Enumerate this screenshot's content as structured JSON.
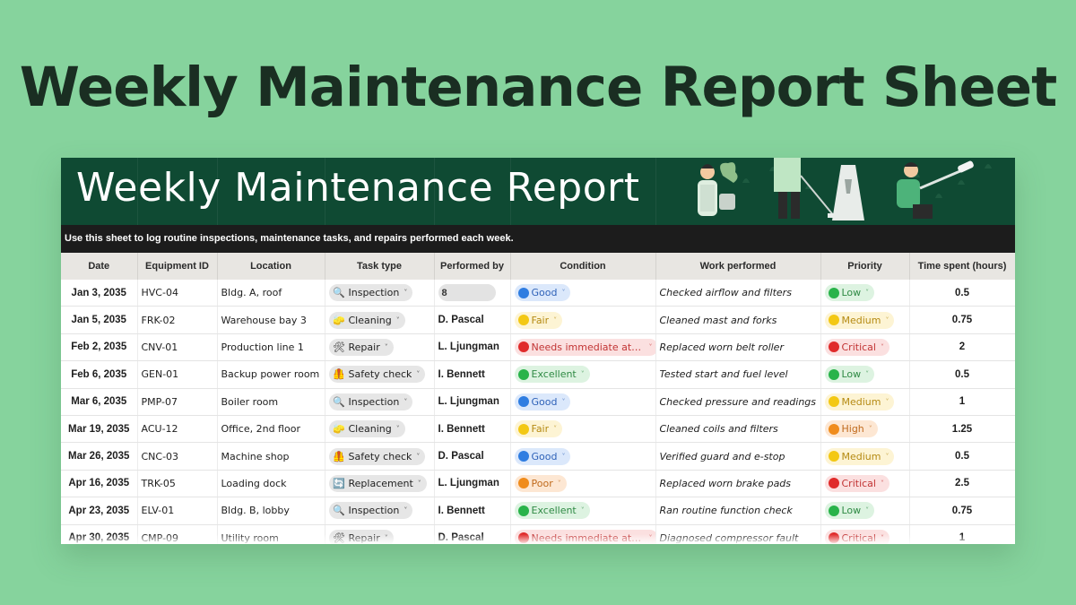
{
  "page_title": "Weekly Maintenance Report Sheet",
  "banner": {
    "title": "Weekly Maintenance Report",
    "subtitle": "Use this sheet to log routine inspections, maintenance tasks, and repairs performed each week."
  },
  "columns": [
    "Date",
    "Equipment ID",
    "Location",
    "Task type",
    "Performed by",
    "Condition",
    "Work performed",
    "Priority",
    "Time spent (hours)"
  ],
  "colors": {
    "background": "#86d39d",
    "banner": "#0f4a33",
    "subbar": "#1c1c1c",
    "header_row": "#e8e6e2",
    "status_blue": "#2f7de1",
    "status_green": "#29b34a",
    "status_yellow": "#f3c814",
    "status_red": "#e02b2b",
    "status_orange": "#f08c1c"
  },
  "task_icons": {
    "Inspection": "magnifier-icon",
    "Cleaning": "sponge-icon",
    "Repair": "tools-icon",
    "Safety check": "safety-vest-icon",
    "Replacement": "cycle-arrows-icon"
  },
  "rows": [
    {
      "date": "Jan 3, 2035",
      "equipment_id": "HVC-04",
      "location": "Bldg. A, roof",
      "task_type": "Inspection",
      "performed_by": "8",
      "condition": "Good",
      "work_performed": "Checked airflow and filters",
      "priority": "Low",
      "time_spent": "0.5"
    },
    {
      "date": "Jan 5, 2035",
      "equipment_id": "FRK-02",
      "location": "Warehouse bay 3",
      "task_type": "Cleaning",
      "performed_by": "D. Pascal",
      "condition": "Fair",
      "work_performed": "Cleaned mast and forks",
      "priority": "Medium",
      "time_spent": "0.75"
    },
    {
      "date": "Feb 2, 2035",
      "equipment_id": "CNV-01",
      "location": "Production line 1",
      "task_type": "Repair",
      "performed_by": "L. Ljungman",
      "condition": "Needs immediate att...",
      "work_performed": "Replaced worn belt roller",
      "priority": "Critical",
      "time_spent": "2"
    },
    {
      "date": "Feb 6, 2035",
      "equipment_id": "GEN-01",
      "location": "Backup power room",
      "task_type": "Safety check",
      "performed_by": "I. Bennett",
      "condition": "Excellent",
      "work_performed": "Tested start and fuel level",
      "priority": "Low",
      "time_spent": "0.5"
    },
    {
      "date": "Mar 6, 2035",
      "equipment_id": "PMP-07",
      "location": "Boiler room",
      "task_type": "Inspection",
      "performed_by": "L. Ljungman",
      "condition": "Good",
      "work_performed": "Checked pressure and readings",
      "priority": "Medium",
      "time_spent": "1"
    },
    {
      "date": "Mar 19, 2035",
      "equipment_id": "ACU-12",
      "location": "Office, 2nd floor",
      "task_type": "Cleaning",
      "performed_by": "I. Bennett",
      "condition": "Fair",
      "work_performed": "Cleaned coils and filters",
      "priority": "High",
      "time_spent": "1.25"
    },
    {
      "date": "Mar 26, 2035",
      "equipment_id": "CNC-03",
      "location": "Machine shop",
      "task_type": "Safety check",
      "performed_by": "D. Pascal",
      "condition": "Good",
      "work_performed": "Verified guard and e-stop",
      "priority": "Medium",
      "time_spent": "0.5"
    },
    {
      "date": "Apr 16, 2035",
      "equipment_id": "TRK-05",
      "location": "Loading dock",
      "task_type": "Replacement",
      "performed_by": "L. Ljungman",
      "condition": "Poor",
      "work_performed": "Replaced worn brake pads",
      "priority": "Critical",
      "time_spent": "2.5"
    },
    {
      "date": "Apr 23, 2035",
      "equipment_id": "ELV-01",
      "location": "Bldg. B, lobby",
      "task_type": "Inspection",
      "performed_by": "I. Bennett",
      "condition": "Excellent",
      "work_performed": "Ran routine function check",
      "priority": "Low",
      "time_spent": "0.75"
    },
    {
      "date": "Apr 30, 2035",
      "equipment_id": "CMP-09",
      "location": "Utility room",
      "task_type": "Repair",
      "performed_by": "D. Pascal",
      "condition": "Needs immediate att...",
      "work_performed": "Diagnosed compressor fault",
      "priority": "Critical",
      "time_spent": "1"
    }
  ]
}
